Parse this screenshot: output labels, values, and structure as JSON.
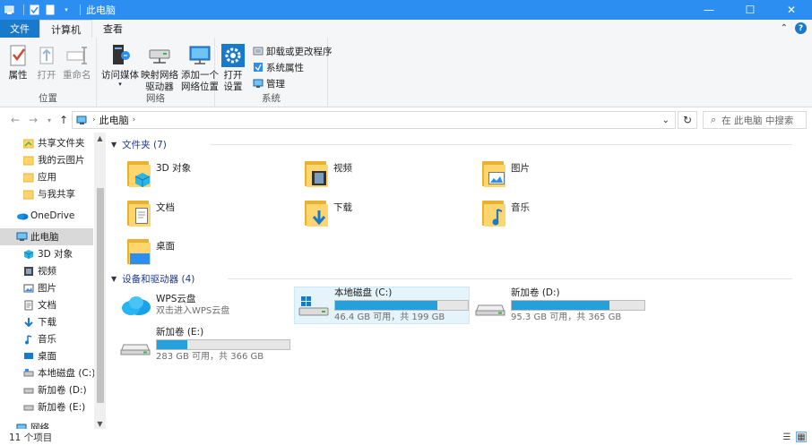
{
  "window": {
    "title": "此电脑",
    "controls": {
      "minimize": "—",
      "maximize": "☐",
      "close": "✕"
    }
  },
  "ribbon_tabs": [
    {
      "label": "文件"
    },
    {
      "label": "计算机"
    },
    {
      "label": "查看"
    }
  ],
  "ribbon": {
    "location": {
      "label": "位置",
      "properties": "属性",
      "open": "打开",
      "rename": "重命名"
    },
    "network": {
      "label": "网络",
      "media_line1": "访问媒体",
      "map_line1": "映射网络",
      "map_line2": "驱动器",
      "add_line1": "添加一个",
      "add_line2": "网络位置"
    },
    "system": {
      "label": "系统",
      "settings_line1": "打开",
      "settings_line2": "设置",
      "uninstall": "卸载或更改程序",
      "sysprops": "系统属性",
      "manage": "管理"
    }
  },
  "address": {
    "path": "此电脑",
    "search_placeholder": "在 此电脑 中搜索"
  },
  "nav": {
    "items": [
      {
        "label": "共享文件夹",
        "icon": "shared-folder-icon"
      },
      {
        "label": "我的云图片",
        "icon": "folder-icon"
      },
      {
        "label": "应用",
        "icon": "folder-icon"
      },
      {
        "label": "与我共享",
        "icon": "folder-icon"
      },
      {
        "label": "OneDrive",
        "icon": "onedrive-icon"
      },
      {
        "label": "此电脑",
        "icon": "this-pc-icon"
      },
      {
        "label": "3D 对象",
        "icon": "3d-objects-icon"
      },
      {
        "label": "视频",
        "icon": "video-icon"
      },
      {
        "label": "图片",
        "icon": "pictures-icon"
      },
      {
        "label": "文档",
        "icon": "documents-icon"
      },
      {
        "label": "下载",
        "icon": "download-icon"
      },
      {
        "label": "音乐",
        "icon": "music-icon"
      },
      {
        "label": "桌面",
        "icon": "desktop-icon"
      },
      {
        "label": "本地磁盘 (C:)",
        "icon": "drive-icon"
      },
      {
        "label": "新加卷 (D:)",
        "icon": "drive-icon"
      },
      {
        "label": "新加卷 (E:)",
        "icon": "drive-icon"
      },
      {
        "label": "网络",
        "icon": "network-icon"
      }
    ]
  },
  "folders": {
    "header": "文件夹 (7)",
    "items": [
      {
        "name": "3D 对象"
      },
      {
        "name": "视频"
      },
      {
        "name": "图片"
      },
      {
        "name": "文档"
      },
      {
        "name": "下载"
      },
      {
        "name": "音乐"
      },
      {
        "name": "桌面"
      }
    ]
  },
  "devices": {
    "header": "设备和驱动器 (4)",
    "wps": {
      "name": "WPS云盘",
      "sub": "双击进入WPS云盘"
    },
    "drives": [
      {
        "name": "本地磁盘 (C:)",
        "sub": "46.4 GB 可用，共 199 GB",
        "used_fraction": 0.767
      },
      {
        "name": "新加卷 (D:)",
        "sub": "95.3 GB 可用，共 365 GB",
        "used_fraction": 0.739
      },
      {
        "name": "新加卷 (E:)",
        "sub": "283 GB 可用，共 366 GB",
        "used_fraction": 0.227
      }
    ]
  },
  "status": {
    "count": "11 个项目"
  },
  "colors": {
    "titlebar": "#2b8ef0",
    "file_tab": "#1979ca",
    "drive_bar": "#26a0da",
    "selection": "#e5f3fb"
  }
}
